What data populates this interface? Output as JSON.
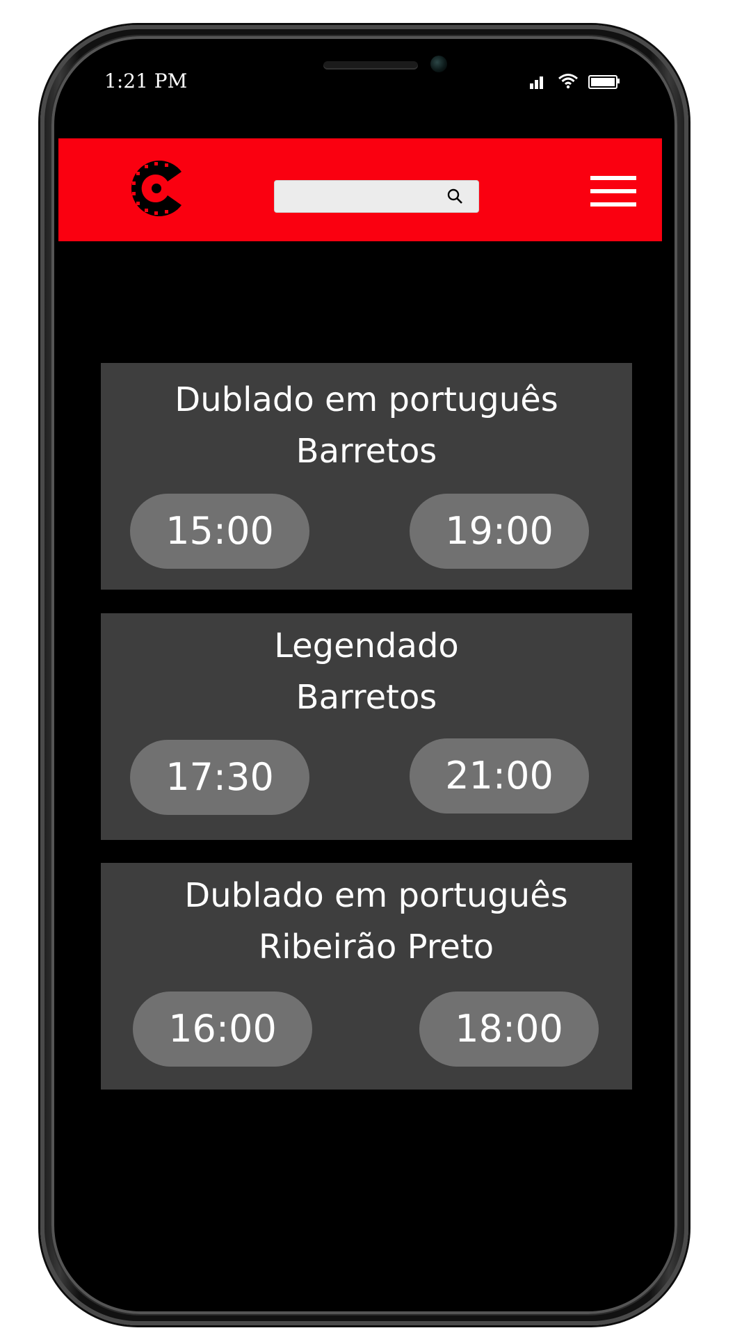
{
  "status_bar": {
    "time": "1:21 PM"
  },
  "header": {
    "search": {
      "placeholder": "",
      "value": ""
    }
  },
  "sessions": [
    {
      "type": "Dublado em português",
      "city": "Barretos",
      "times": [
        "15:00",
        "19:00"
      ]
    },
    {
      "type": "Legendado",
      "city": "Barretos",
      "times": [
        "17:30",
        "21:00"
      ]
    },
    {
      "type": "Dublado em português",
      "city": "Ribeirão Preto",
      "times": [
        "16:00",
        "18:00"
      ]
    }
  ],
  "colors": {
    "header": "#fa0010",
    "card": "#3e3e3e",
    "time_button": "#717171",
    "background": "#000000"
  }
}
